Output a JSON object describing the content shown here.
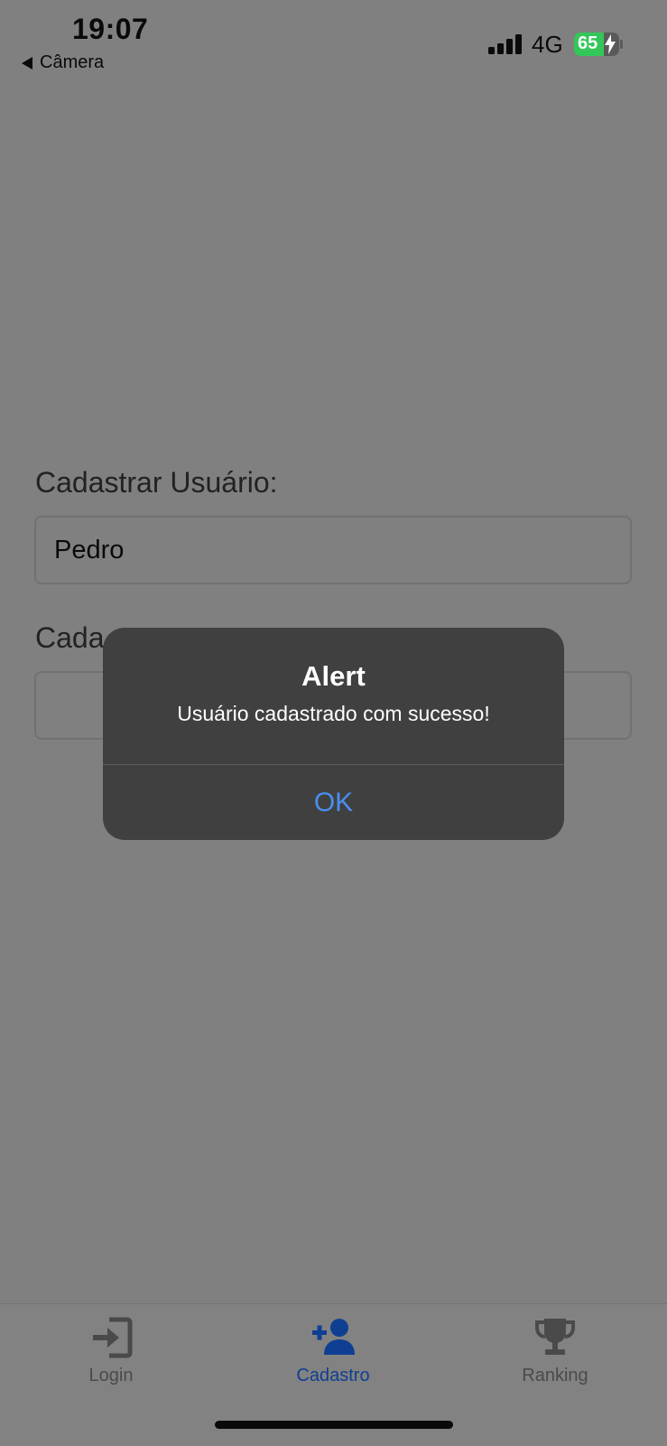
{
  "status_bar": {
    "time": "19:07",
    "back_app": "Câmera",
    "network": "4G",
    "battery": "65",
    "battery_level": 0.65
  },
  "form": {
    "user_label": "Cadastrar Usuário:",
    "user_value": "Pedro",
    "second_label_visible": "Cada"
  },
  "alert": {
    "title": "Alert",
    "message": "Usuário cadastrado com sucesso!",
    "ok_label": "OK"
  },
  "tabbar": {
    "tabs": [
      {
        "label": "Login",
        "icon": "login-icon",
        "active": false
      },
      {
        "label": "Cadastro",
        "icon": "add-user-icon",
        "active": true
      },
      {
        "label": "Ranking",
        "icon": "trophy-icon",
        "active": false
      }
    ]
  },
  "colors": {
    "overlay_background": "#808080",
    "alert_background": "#404040",
    "alert_button": "#4a8ef0",
    "tab_active": "#0f3f92",
    "tab_inactive": "#4a4a4a",
    "battery_green": "#33c759"
  }
}
